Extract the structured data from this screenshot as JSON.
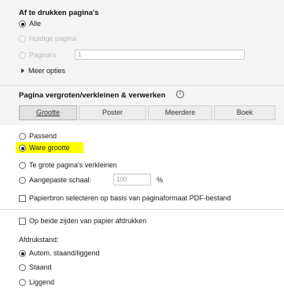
{
  "print_range": {
    "title": "Af te drukken pagina's",
    "options": [
      {
        "label": "Alle",
        "checked": true,
        "disabled": false
      },
      {
        "label": "Huidige pagina",
        "checked": false,
        "disabled": true
      },
      {
        "label": "Pagina's",
        "checked": false,
        "disabled": true
      }
    ],
    "pages_value": "1",
    "more_options": "Meer opties"
  },
  "scaling": {
    "title": "Pagina vergroten/verkleinen & verwerken",
    "info_icon": "info-icon",
    "buttons": [
      "Grootte",
      "Poster",
      "Meerdere",
      "Boek"
    ],
    "options": [
      {
        "label": "Passend",
        "checked": false
      },
      {
        "label": "Ware grootte",
        "checked": true,
        "highlighted": true
      },
      {
        "label": "Te grote pagina's verkleinen",
        "checked": false
      },
      {
        "label": "Aangepaste schaal:",
        "checked": false
      }
    ],
    "scale_value": "100",
    "scale_unit": "%",
    "paper_source_label": "Papierbron selecteren op basis van paginaformaat PDF-bestand"
  },
  "duplex": {
    "label": "Op beide zijden van papier afdrukken"
  },
  "orientation": {
    "title": "Afdrukstand:",
    "options": [
      {
        "label": "Autom. staand/liggend",
        "checked": true
      },
      {
        "label": "Staand",
        "checked": false
      },
      {
        "label": "Liggend",
        "checked": false
      }
    ]
  },
  "colors": {
    "highlight": "#ffff00"
  }
}
